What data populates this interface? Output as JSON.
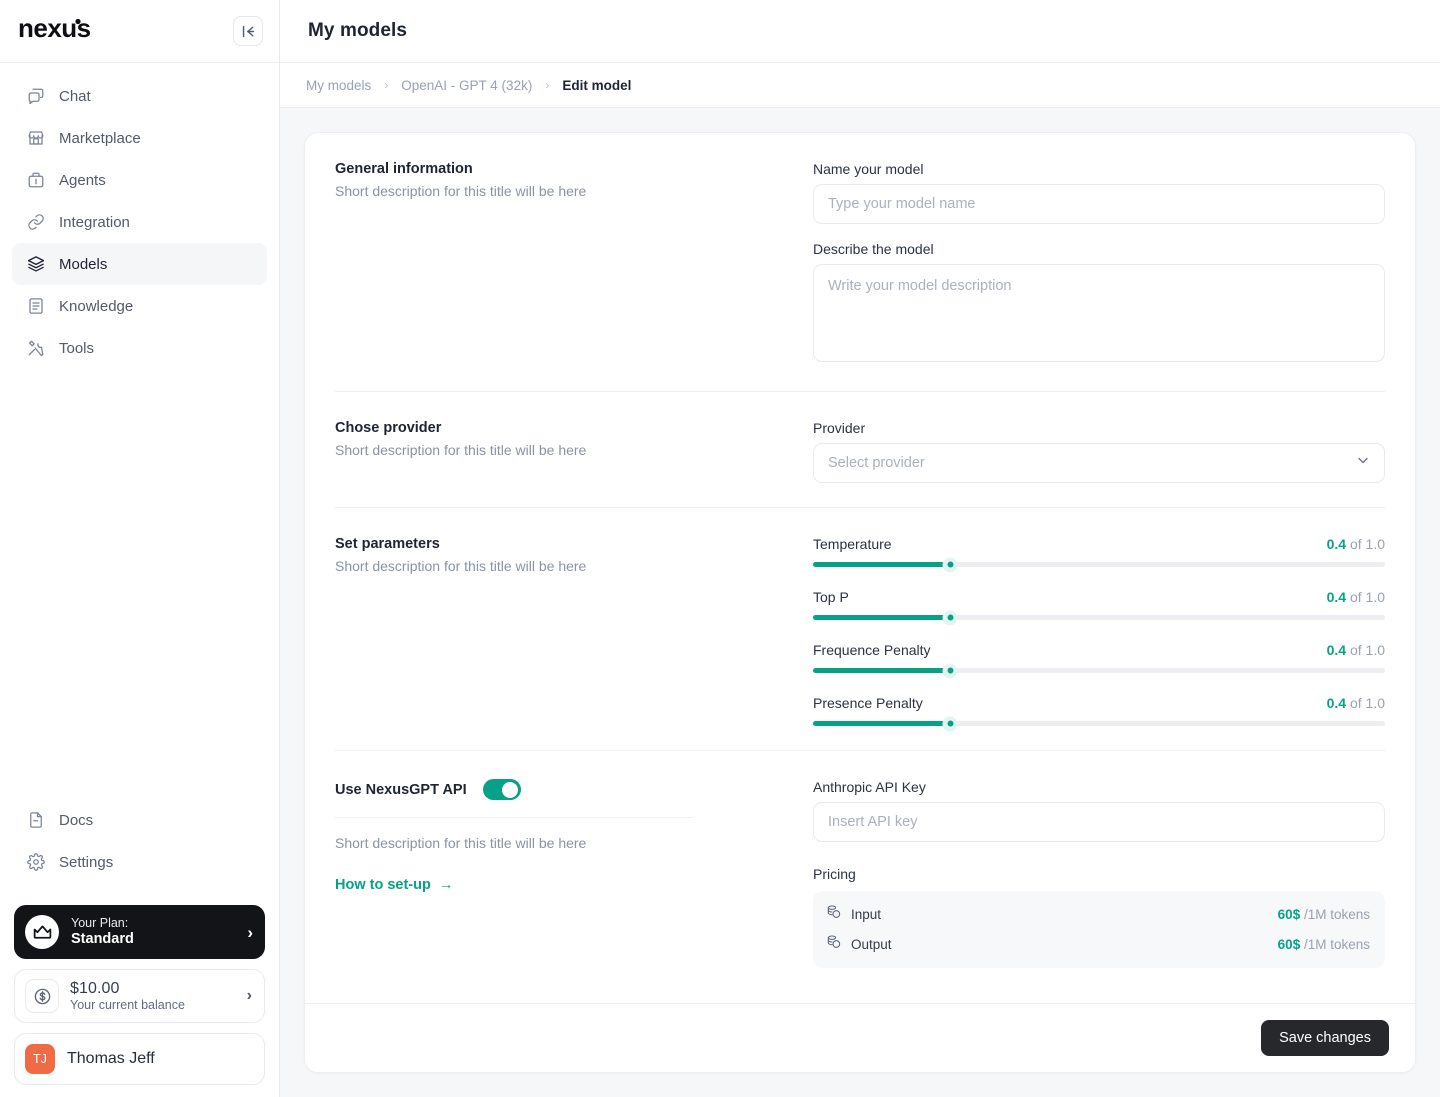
{
  "brand": {
    "name": "nexus"
  },
  "sidebar": {
    "collapse_icon": "collapse-left-icon",
    "nav": [
      {
        "label": "Chat",
        "icon": "chat-icon",
        "active": false
      },
      {
        "label": "Marketplace",
        "icon": "store-icon",
        "active": false
      },
      {
        "label": "Agents",
        "icon": "briefcase-icon",
        "active": false
      },
      {
        "label": "Integration",
        "icon": "link-icon",
        "active": false
      },
      {
        "label": "Models",
        "icon": "layers-icon",
        "active": true
      },
      {
        "label": "Knowledge",
        "icon": "document-icon",
        "active": false
      },
      {
        "label": "Tools",
        "icon": "tools-icon",
        "active": false
      }
    ],
    "bottom_nav": [
      {
        "label": "Docs",
        "icon": "file-icon"
      },
      {
        "label": "Settings",
        "icon": "gear-icon"
      }
    ],
    "plan": {
      "caption": "Your Plan:",
      "value": "Standard",
      "icon": "crown-icon",
      "chevron": "chevron-right-icon"
    },
    "balance": {
      "amount": "$10.00",
      "caption": "Your current balance",
      "icon": "dollar-coin-icon",
      "chevron": "chevron-right-icon"
    },
    "user": {
      "initials": "TJ",
      "name": "Thomas Jeff"
    }
  },
  "header": {
    "title": "My models"
  },
  "breadcrumb": {
    "items": [
      "My models",
      "OpenAI - GPT 4 (32k)",
      "Edit model"
    ],
    "separator": "›"
  },
  "sections": {
    "general": {
      "title": "General information",
      "description": "Short description for this title will be here",
      "name_label": "Name your model",
      "name_value": "",
      "name_placeholder": "Type your model name",
      "desc_label": "Describe the model",
      "desc_value": "",
      "desc_placeholder": "Write your model description"
    },
    "provider": {
      "title": "Chose provider",
      "description": "Short description for this title will be here",
      "field_label": "Provider",
      "selected": "",
      "placeholder": "Select provider",
      "chevron": "chevron-down-icon"
    },
    "parameters": {
      "title": "Set parameters",
      "description": "Short description for this title will be here",
      "unit_suffix": "of 1.0",
      "sliders": [
        {
          "label": "Temperature",
          "value": "0.4",
          "max": "1.0",
          "percent": 24
        },
        {
          "label": "Top P",
          "value": "0.4",
          "max": "1.0",
          "percent": 24
        },
        {
          "label": "Frequence Penalty",
          "value": "0.4",
          "max": "1.0",
          "percent": 24
        },
        {
          "label": "Presence Penalty",
          "value": "0.4",
          "max": "1.0",
          "percent": 24
        }
      ]
    },
    "api": {
      "title": "Use NexusGPT API",
      "toggle_on": true,
      "description": "Short description for this title will be here",
      "setup_link": "How to set-up",
      "setup_arrow": "→",
      "key_label": "Anthropic API Key",
      "key_value": "",
      "key_placeholder": "Insert API key",
      "pricing_label": "Pricing",
      "pricing_rows": [
        {
          "name": "Input",
          "price": "60$",
          "unit": "/1M tokens",
          "icon": "coins-icon"
        },
        {
          "name": "Output",
          "price": "60$",
          "unit": "/1M tokens",
          "icon": "coins-icon"
        }
      ]
    }
  },
  "footer": {
    "save_label": "Save changes"
  },
  "colors": {
    "accent": "#07a187",
    "dark": "#131417",
    "avatar": "#ef6b46"
  }
}
